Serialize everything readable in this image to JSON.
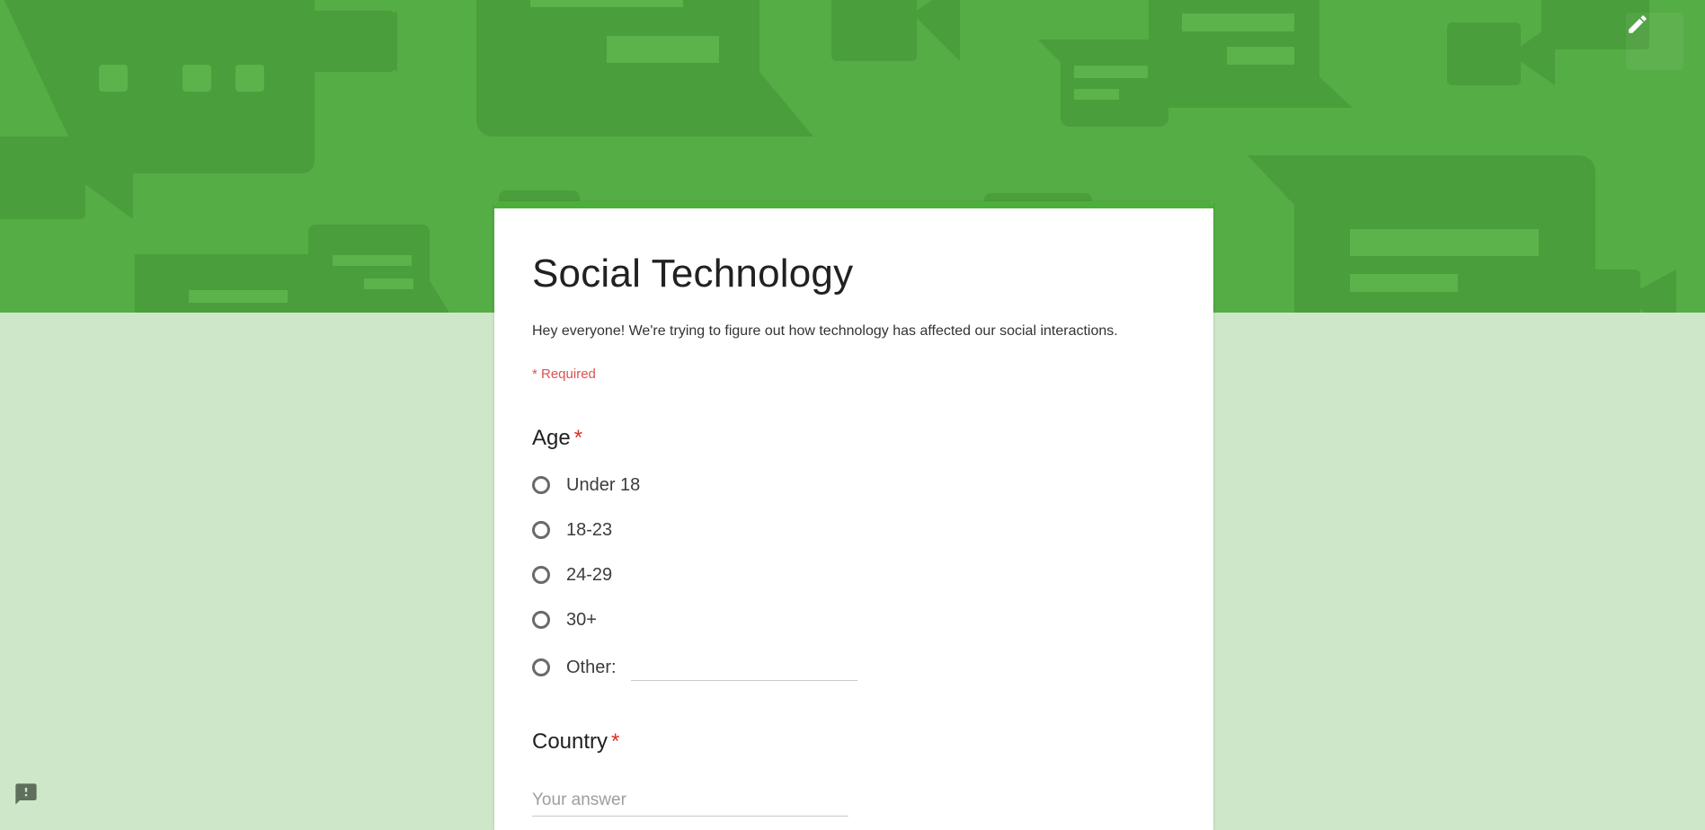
{
  "form": {
    "title": "Social Technology",
    "description": "Hey everyone! We're trying to figure out how technology has affected our social interactions.",
    "required_note": "* Required"
  },
  "questions": {
    "age": {
      "label": "Age",
      "required_mark": "*",
      "options": [
        "Under 18",
        "18-23",
        "24-29",
        "30+"
      ],
      "other_label": "Other:"
    },
    "country": {
      "label": "Country",
      "required_mark": "*",
      "placeholder": "Your answer"
    }
  },
  "icons": {
    "edit": "pencil-icon",
    "feedback": "report-feedback-icon"
  },
  "colors": {
    "banner": "#55ad45",
    "page_background": "#cfe7c9",
    "accent": "#4caf3a",
    "required": "#d93025"
  }
}
